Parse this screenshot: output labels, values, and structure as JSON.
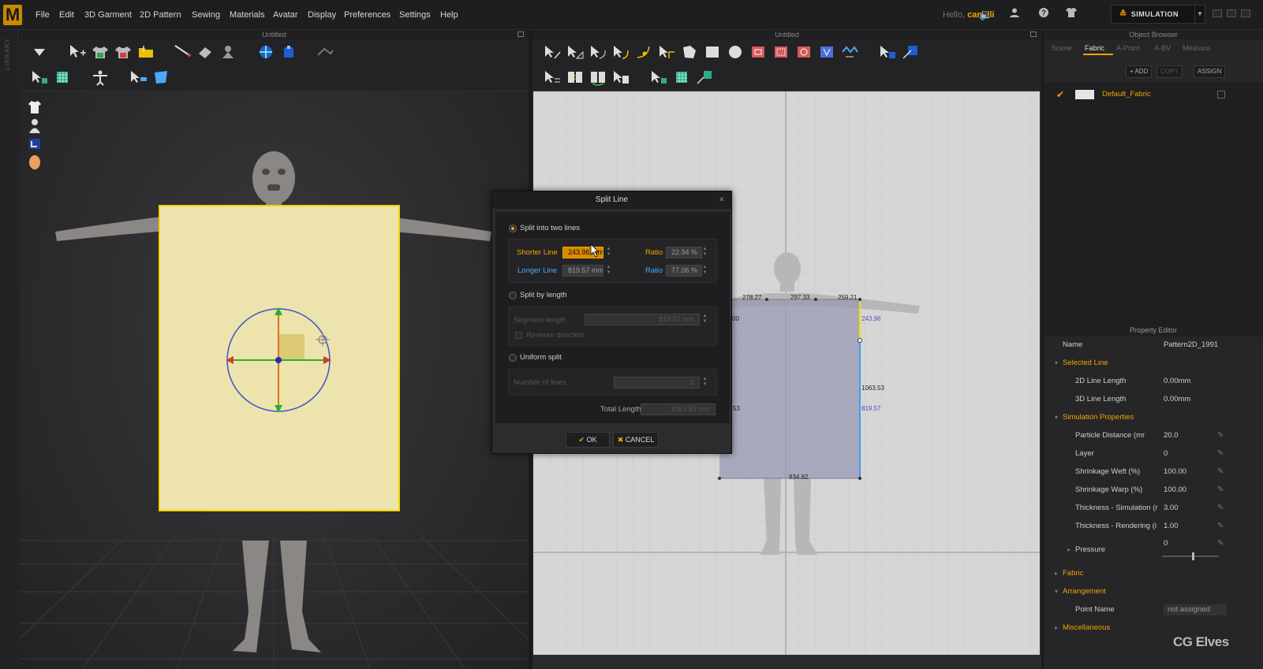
{
  "menu": {
    "logo": "M",
    "items": [
      "File",
      "Edit",
      "3D Garment",
      "2D Pattern",
      "Sewing",
      "Materials",
      "Avatar",
      "Display",
      "Preferences",
      "Settings",
      "Help"
    ],
    "hello_prefix": "Hello,",
    "username": "camilli",
    "mode_label": "SIMULATION",
    "accent_color": "#f0a500"
  },
  "left_strip": {
    "label": "LIBRARY"
  },
  "panel3d": {
    "title": "Untitled"
  },
  "panel2d": {
    "title": "Untitled",
    "dims": {
      "top_left": "278.27",
      "top_mid": "297.33",
      "top_right": "259.21",
      "left_edge": "00",
      "right_yellow": "243.96",
      "right_total": "1063.53",
      "right_blue": "819.57",
      "left_lower": "53",
      "bottom": "834.82"
    }
  },
  "object_browser": {
    "title": "Object Browser",
    "tabs": [
      "Scene",
      "Fabric",
      "A-Point",
      "A-BV",
      "Measure"
    ],
    "active_tab": "Fabric",
    "buttons": {
      "add": "ADD",
      "copy": "COPY",
      "assign": "ASSIGN"
    },
    "items": [
      {
        "name": "Default_Fabric"
      }
    ]
  },
  "property_editor": {
    "title": "Property Editor",
    "name_label": "Name",
    "name_value": "Pattern2D_1991",
    "sections": {
      "selected_line": "Selected Line",
      "simulation": "Simulation Properties",
      "fabric": "Fabric",
      "arrangement": "Arrangement",
      "misc": "Miscellaneous"
    },
    "rows": {
      "line2d": {
        "label": "2D Line Length",
        "value": "0.00mm"
      },
      "line3d": {
        "label": "3D Line Length",
        "value": "0.00mm"
      },
      "particle": {
        "label": "Particle Distance (mr",
        "value": "20.0"
      },
      "layer": {
        "label": "Layer",
        "value": "0"
      },
      "weft": {
        "label": "Shrinkage Weft (%)",
        "value": "100.00"
      },
      "warp": {
        "label": "Shrinkage Warp (%)",
        "value": "100.00"
      },
      "thick_sim": {
        "label": "Thickness - Simulation (r",
        "value": "3.00"
      },
      "thick_ren": {
        "label": "Thickness - Rendering (i",
        "value": "1.00"
      },
      "pressure": {
        "label": "Pressure",
        "value": "0"
      },
      "point_name": {
        "label": "Point Name",
        "value": "not assigned"
      }
    }
  },
  "dialog": {
    "title": "Split Line",
    "option_two_lines": "Split into two lines",
    "shorter_label": "Shorter Line",
    "shorter_value": "243.96 mm",
    "shorter_ratio_label": "Ratio",
    "shorter_ratio": "22.94 %",
    "longer_label": "Longer Line",
    "longer_value": "819.57 mm",
    "longer_ratio_label": "Ratio",
    "longer_ratio": "77.06 %",
    "option_by_length": "Split by length",
    "segment_label": "Segment length",
    "segment_value": "819.57 mm",
    "reverse_label": "Reverse direction",
    "option_uniform": "Uniform split",
    "lines_label": "Number of lines",
    "lines_value": "2",
    "total_label": "Total Length",
    "total_value": "1063.53 mm",
    "ok": "OK",
    "cancel": "CANCEL",
    "selected_option": "Split into two lines"
  },
  "watermark": "CG Elves"
}
